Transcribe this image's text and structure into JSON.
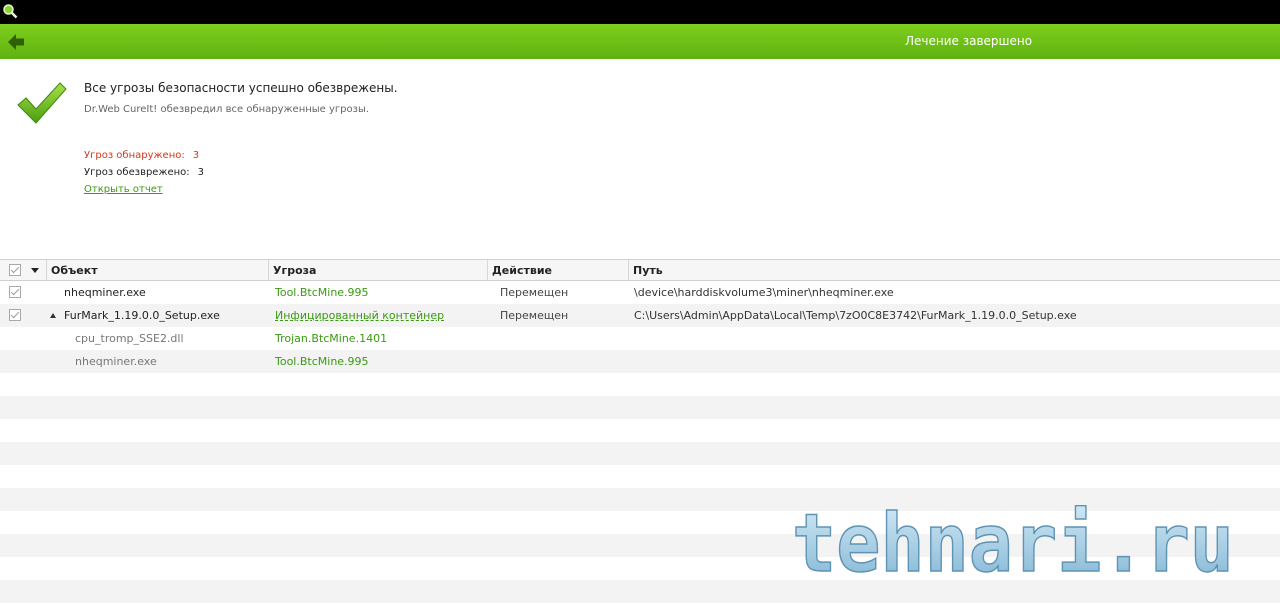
{
  "header": {
    "title": "Лечение завершено",
    "accent": "#6bbf16"
  },
  "summary": {
    "title": "Все угрозы безопасности успешно обезврежены.",
    "subtitle": "Dr.Web CureIt! обезвредил все обнаруженные угрозы.",
    "found_label": "Угроз обнаружено:",
    "found_value": "3",
    "neutralized_label": "Угроз обезврежено:",
    "neutralized_value": "3",
    "report_link": "Открыть отчет"
  },
  "table": {
    "columns": {
      "object": "Объект",
      "threat": "Угроза",
      "action": "Действие",
      "path": "Путь"
    },
    "rows": [
      {
        "object": "nheqminer.exe",
        "threat": "Tool.BtcMine.995",
        "action": "Перемещен",
        "path": "\\device\\harddiskvolume3\\miner\\nheqminer.exe"
      },
      {
        "object": "FurMark_1.19.0.0_Setup.exe",
        "threat": "Инфицированный контейнер",
        "action": "Перемещен",
        "path": "C:\\Users\\Admin\\AppData\\Local\\Temp\\7zO0C8E3742\\FurMark_1.19.0.0_Setup.exe"
      },
      {
        "object": "cpu_tromp_SSE2.dll",
        "threat": "Trojan.BtcMine.1401"
      },
      {
        "object": "nheqminer.exe",
        "threat": "Tool.BtcMine.995"
      }
    ]
  },
  "watermark": {
    "text": "tehnari.ru"
  },
  "icons": {
    "app": "drweb-search-icon",
    "back": "back-arrow-icon",
    "success": "checkmark-icon"
  }
}
